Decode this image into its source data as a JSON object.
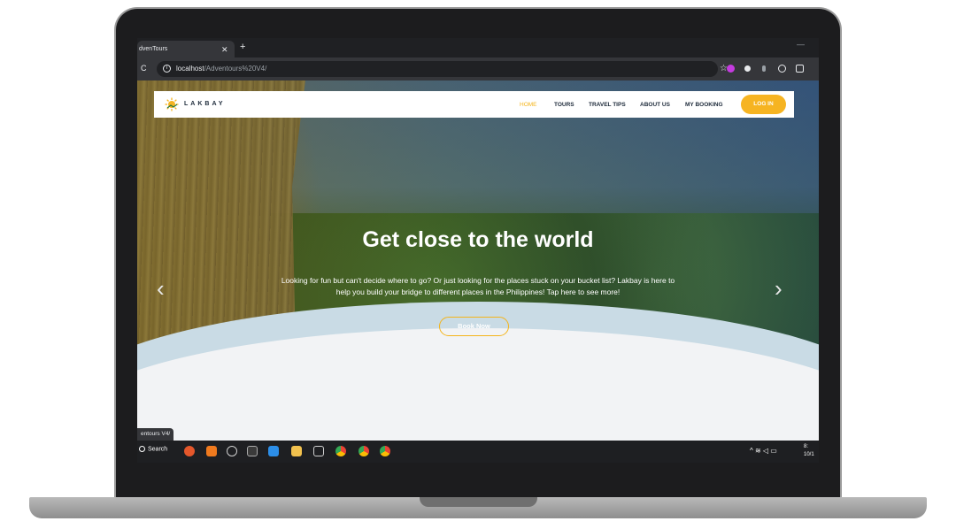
{
  "browser": {
    "tab_title": "dvenTours",
    "tab_close": "✕",
    "new_tab": "+",
    "minimize": "—",
    "reload": "C",
    "url_host": "localhost",
    "url_path": "/Adventours%20V4/",
    "star": "☆"
  },
  "navbar": {
    "logo_text": "LAKBAY",
    "links": [
      "HOME",
      "TOURS",
      "TRAVEL TIPS",
      "ABOUT US",
      "MY BOOKING"
    ],
    "login_label": "LOG IN"
  },
  "hero": {
    "title": "Get close to the world",
    "description": "Looking for fun but can't decide where to go? Or just looking for the places stuck on your bucket list? Lakbay is here to help you build your bridge to different places in the Philippines! Tap here to see more!",
    "button_label": "Book Now",
    "prev_arrow": "‹",
    "next_arrow": "›"
  },
  "status_bubble": "entours V4/",
  "taskbar": {
    "search_label": "Search",
    "tray_symbols": "^  ≋ ◁ ▭",
    "clock_time": "8:",
    "clock_date": "10/1"
  },
  "colors": {
    "accent": "#f4b41a",
    "nav_text": "#1d2a3a"
  }
}
